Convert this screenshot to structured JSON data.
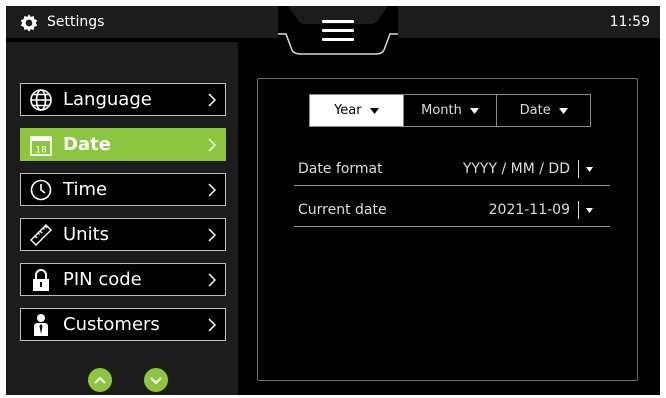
{
  "header": {
    "title": "Settings",
    "time": "11:59",
    "title_icon": "gear-icon",
    "menu_icon": "hamburger-menu-icon"
  },
  "sidebar": {
    "items": [
      {
        "label": "Language",
        "icon": "globe-icon",
        "active": false
      },
      {
        "label": "Date",
        "icon": "calendar-icon",
        "calendar_day": "18",
        "active": true
      },
      {
        "label": "Time",
        "icon": "clock-icon",
        "active": false
      },
      {
        "label": "Units",
        "icon": "ruler-icon",
        "active": false
      },
      {
        "label": "PIN code",
        "icon": "lock-icon",
        "active": false
      },
      {
        "label": "Customers",
        "icon": "person-icon",
        "active": false
      }
    ],
    "scroll_up_icon": "chevron-up-icon",
    "scroll_down_icon": "chevron-down-icon"
  },
  "main": {
    "segments": [
      {
        "label": "Year",
        "selected": true
      },
      {
        "label": "Month",
        "selected": false
      },
      {
        "label": "Date",
        "selected": false
      }
    ],
    "rows": [
      {
        "label": "Date format",
        "value": "YYYY / MM / DD"
      },
      {
        "label": "Current date",
        "value": "2021-11-09"
      }
    ]
  },
  "colors": {
    "accent": "#8cc63f",
    "background": "#000000",
    "bar": "#1c1c1c",
    "border": "#bdbdbd"
  }
}
